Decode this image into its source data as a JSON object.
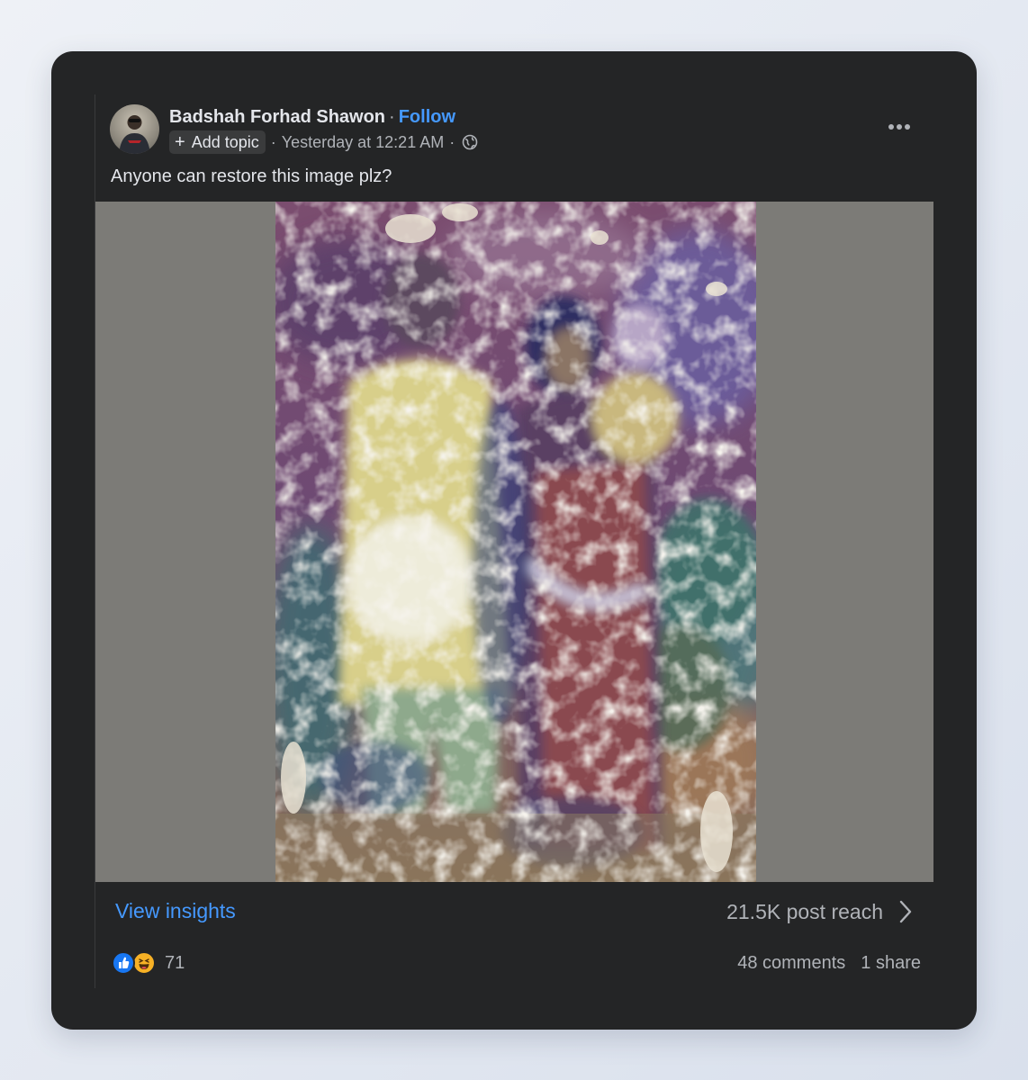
{
  "post": {
    "author": "Badshah Forhad Shawon",
    "separator": "·",
    "follow_label": "Follow",
    "add_topic_label": "Add topic",
    "add_topic_icon": "plus-icon",
    "timestamp": "Yesterday at 12:21 AM",
    "privacy_icon": "globe-icon",
    "more_icon": "more-horizontal-icon",
    "caption": "Anyone can restore this image plz?"
  },
  "insights": {
    "view_label": "View insights",
    "reach_label": "21.5K post reach",
    "chevron_icon": "chevron-right-icon"
  },
  "engagement": {
    "reaction_icons": [
      "like-icon",
      "haha-icon"
    ],
    "reaction_count": "71",
    "comments": "48 comments",
    "shares": "1 share"
  },
  "colors": {
    "card_bg": "#242526",
    "link_blue": "#4599ff",
    "primary_text": "#e4e6eb",
    "secondary_text": "#b0b3b8",
    "media_letterbox": "#7c7b77"
  }
}
